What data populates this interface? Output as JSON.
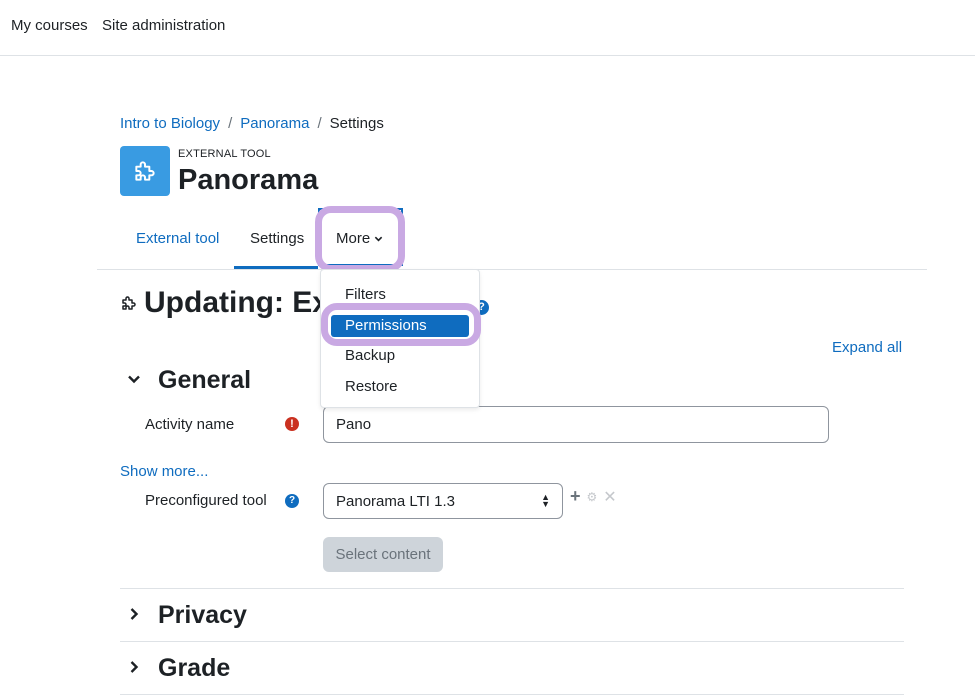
{
  "topnav": {
    "my_courses": "My courses",
    "site_admin": "Site administration"
  },
  "breadcrumb": {
    "course": "Intro to Biology",
    "activity": "Panorama",
    "current": "Settings",
    "sep": "/"
  },
  "activity": {
    "kind": "EXTERNAL TOOL",
    "title": "Panorama"
  },
  "tabs": {
    "external_tool": "External tool",
    "settings": "Settings",
    "more": "More"
  },
  "more_menu": {
    "items": [
      "Filters",
      "Permissions",
      "Backup",
      "Restore"
    ],
    "active": "Permissions"
  },
  "page": {
    "heading": "Updating: Ex",
    "expand_all": "Expand all"
  },
  "sections": {
    "general": "General",
    "privacy": "Privacy",
    "grade": "Grade"
  },
  "form": {
    "activity_name_label": "Activity name",
    "activity_name_value": "Pano",
    "show_more": "Show more...",
    "preconfigured_tool_label": "Preconfigured tool",
    "preconfigured_tool_value": "Panorama LTI 1.3",
    "select_content": "Select content"
  },
  "colors": {
    "link": "#0f6cbf",
    "highlight": "#c9a9e3",
    "activity_icon": "#399be2",
    "required": "#ca3120"
  }
}
